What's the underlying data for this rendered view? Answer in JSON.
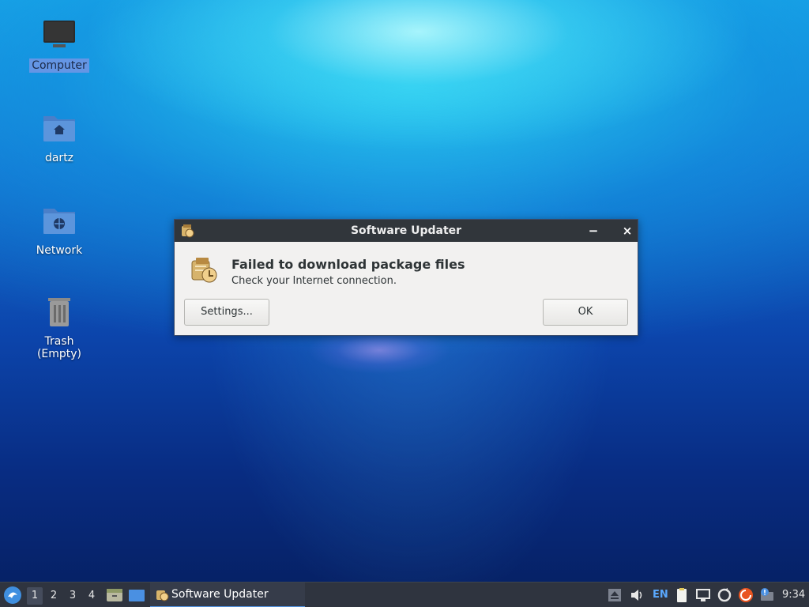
{
  "desktop": {
    "icons": [
      {
        "label": "Computer"
      },
      {
        "label": "dartz"
      },
      {
        "label": "Network"
      },
      {
        "label": "Trash (Empty)"
      }
    ]
  },
  "dialog": {
    "title": "Software Updater",
    "minimize_glyph": "−",
    "close_glyph": "×",
    "heading": "Failed to download package files",
    "message": "Check your Internet connection.",
    "settings_button": "Settings...",
    "ok_button": "OK"
  },
  "taskbar": {
    "workspaces": [
      "1",
      "2",
      "3",
      "4"
    ],
    "active_workspace": "1",
    "task_label": "Software Updater",
    "language": "EN",
    "clock": "9:34",
    "accent_color": "#5294e2"
  }
}
